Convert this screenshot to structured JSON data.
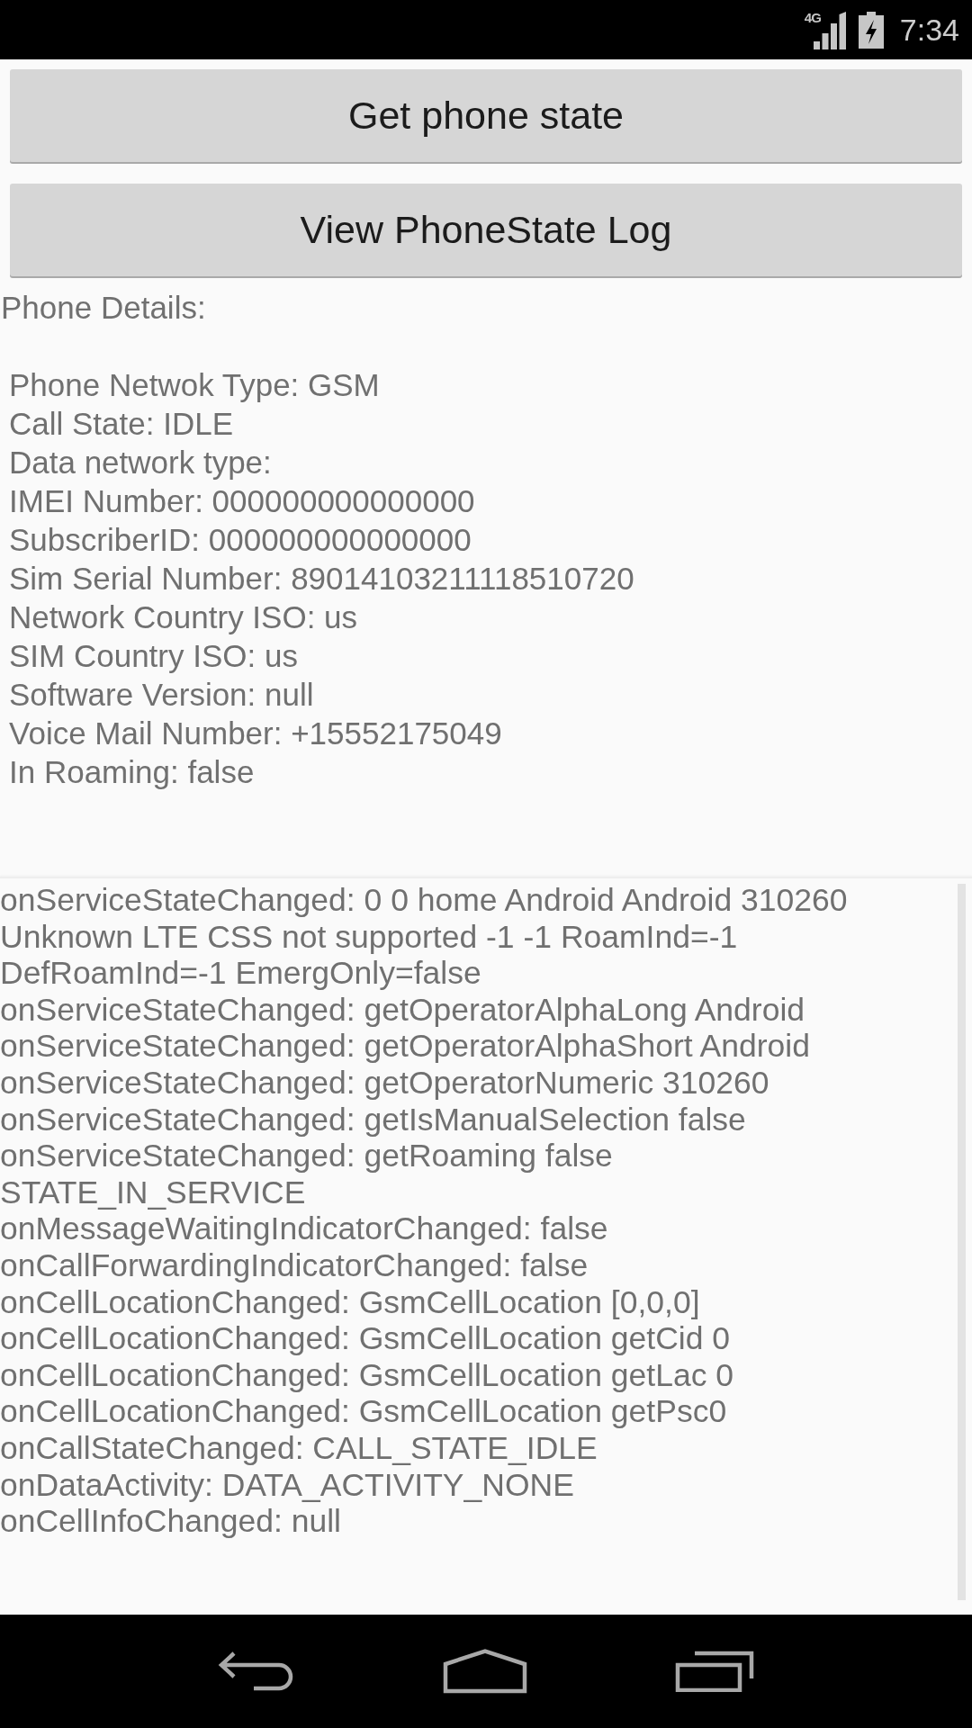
{
  "status_bar": {
    "network": "4G",
    "time": "7:34"
  },
  "buttons": [
    {
      "label": "Get phone state"
    },
    {
      "label": "View PhoneState Log"
    }
  ],
  "details": {
    "heading": "Phone Details:",
    "lines": [
      "Phone Netwok Type: GSM",
      "Call State: IDLE",
      "Data network type:",
      "IMEI Number: 000000000000000",
      "SubscriberID: 000000000000000",
      "Sim Serial Number: 89014103211118510720",
      "Network Country ISO: us",
      "SIM Country ISO: us",
      "Software Version: null",
      "Voice Mail Number: +15552175049",
      "In Roaming: false"
    ]
  },
  "log": {
    "entries": [
      "onServiceStateChanged: 0 0 home Android Android 310260 Unknown LTE CSS not supported -1 -1 RoamInd=-1 DefRoamInd=-1 EmergOnly=false",
      "onServiceStateChanged: getOperatorAlphaLong Android",
      "onServiceStateChanged: getOperatorAlphaShort Android",
      "onServiceStateChanged: getOperatorNumeric 310260",
      "onServiceStateChanged: getIsManualSelection false",
      "onServiceStateChanged: getRoaming false",
      "STATE_IN_SERVICE",
      "onMessageWaitingIndicatorChanged: false",
      "onCallForwardingIndicatorChanged: false",
      "onCellLocationChanged: GsmCellLocation [0,0,0]",
      "onCellLocationChanged: GsmCellLocation getCid 0",
      "onCellLocationChanged: GsmCellLocation getLac 0",
      "onCellLocationChanged: GsmCellLocation getPsc0",
      "onCallStateChanged: CALL_STATE_IDLE",
      "onDataActivity: DATA_ACTIVITY_NONE",
      "onCellInfoChanged: null"
    ]
  }
}
